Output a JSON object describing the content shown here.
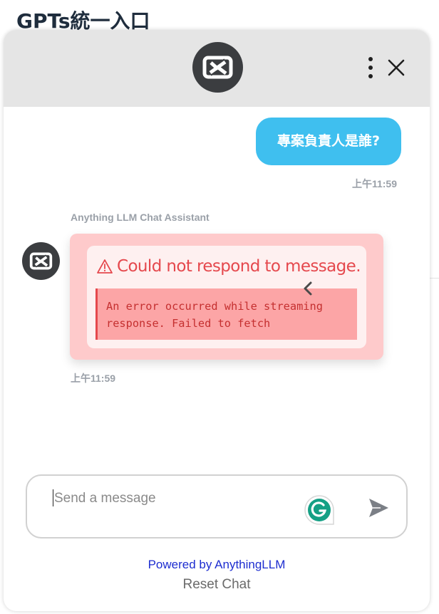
{
  "page": {
    "title": "GPTs統一入口"
  },
  "header": {
    "logo_icon": "anythingllm-logo-icon",
    "menu_icon": "kebab-menu-icon",
    "close_icon": "close-icon"
  },
  "messages": {
    "user": {
      "text": "專案負責人是誰?",
      "time": "上午11:59"
    },
    "assistant": {
      "name": "Anything LLM Chat Assistant",
      "error_title": "Could not respond to message.",
      "error_detail": "An error occurred while streaming\nresponse. Failed to fetch",
      "time": "上午11:59"
    }
  },
  "composer": {
    "placeholder": "Send a message",
    "grammarly_icon": "grammarly-icon",
    "send_icon": "send-icon"
  },
  "footer": {
    "powered_by": "Powered by AnythingLLM",
    "reset": "Reset Chat"
  },
  "colors": {
    "user_bubble": "#3fbfef",
    "error_text": "#e5484d",
    "powered_link": "#1d2dd0"
  }
}
